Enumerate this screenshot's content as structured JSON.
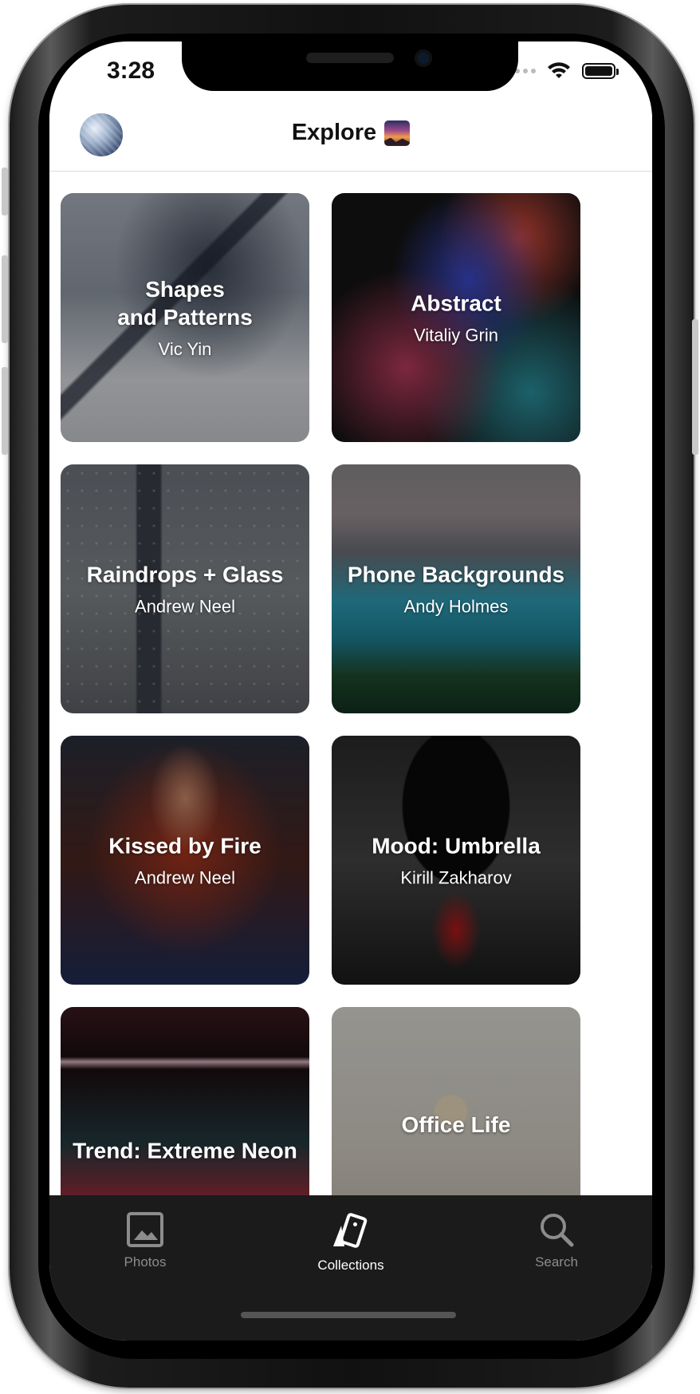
{
  "status_bar": {
    "time": "3:28"
  },
  "header": {
    "title": "Explore"
  },
  "collections": [
    {
      "title": "Shapes and Patterns",
      "title_line1": "Shapes",
      "title_line2": "and Patterns",
      "author": "Vic Yin"
    },
    {
      "title": "Abstract",
      "author": "Vitaliy Grin"
    },
    {
      "title": "Raindrops + Glass",
      "author": "Andrew Neel"
    },
    {
      "title": "Phone Backgrounds",
      "author": "Andy Holmes"
    },
    {
      "title": "Kissed by Fire",
      "author": "Andrew Neel"
    },
    {
      "title": "Mood: Umbrella",
      "author": "Kirill Zakharov"
    },
    {
      "title": "Trend: Extreme Neon",
      "author": ""
    },
    {
      "title": "Office Life",
      "author": ""
    }
  ],
  "tab_bar": {
    "tabs": [
      {
        "label": "Photos",
        "icon": "photo-icon",
        "active": false
      },
      {
        "label": "Collections",
        "icon": "collections-icon",
        "active": true
      },
      {
        "label": "Search",
        "icon": "search-icon",
        "active": false
      }
    ]
  },
  "colors": {
    "tab_bar_bg": "#1b1b1b",
    "tab_active": "#ffffff",
    "tab_inactive": "#8c8c8c"
  }
}
